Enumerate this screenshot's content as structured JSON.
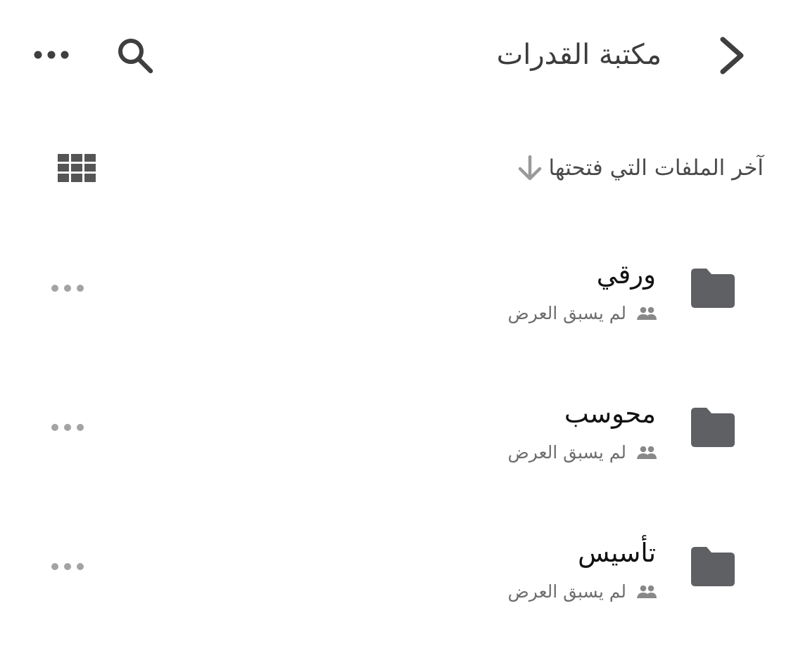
{
  "header": {
    "title": "مكتبة القدرات",
    "back_icon": "chevron-right-icon",
    "search_icon": "search-icon",
    "more_icon": "more-horizontal-icon"
  },
  "sort": {
    "label": "آخر الملفات التي فتحتها",
    "arrow_icon": "arrow-down-icon"
  },
  "view_toggle": {
    "icon": "grid-view-icon"
  },
  "folders": [
    {
      "name": "ورقي",
      "status": "لم يسبق العرض",
      "icon": "folder-icon",
      "shared_icon": "shared-people-icon"
    },
    {
      "name": "محوسب",
      "status": "لم يسبق العرض",
      "icon": "folder-icon",
      "shared_icon": "shared-people-icon"
    },
    {
      "name": "تأسيس",
      "status": "لم يسبق العرض",
      "icon": "folder-icon",
      "shared_icon": "shared-people-icon"
    }
  ],
  "colors": {
    "background": "#ffffff",
    "title_text": "#3c3c3c",
    "folder_icon": "#5f6063",
    "secondary_text": "#6d6d6d",
    "muted_icon": "#a3a3a3"
  }
}
